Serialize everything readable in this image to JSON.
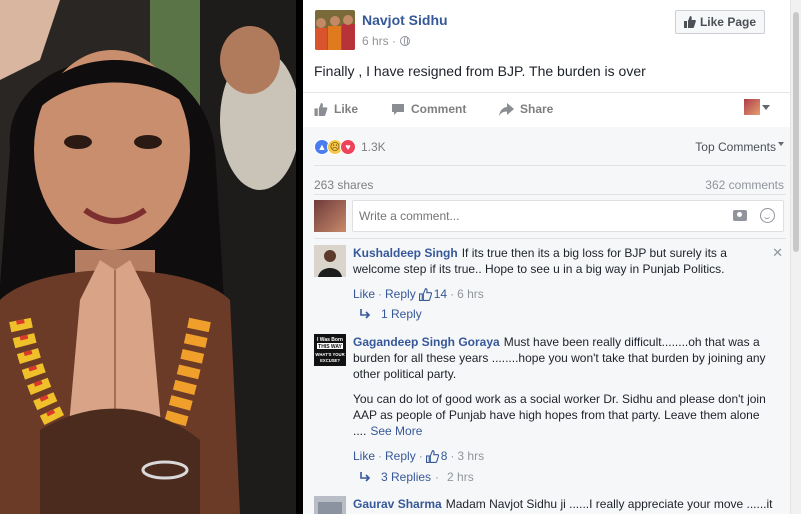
{
  "post": {
    "page_name": "Navjot Sidhu",
    "time": "6 hrs",
    "privacy_icon": "globe-icon",
    "like_page_label": "Like Page",
    "text": "Finally , I have resigned from BJP. The burden is over"
  },
  "actions": {
    "like_label": "Like",
    "comment_label": "Comment",
    "share_label": "Share"
  },
  "stats": {
    "reactions_count": "1.3K",
    "top_comments_label": "Top Comments",
    "shares": "263 shares",
    "comments": "362 comments"
  },
  "composer": {
    "placeholder": "Write a comment..."
  },
  "comments": [
    {
      "author": "Kushaldeep Singh",
      "text": "If its true then its a big loss for BJP but surely its a welcome step if its true.. Hope to see u in a big way in Punjab Politics.",
      "like": "Like",
      "reply": "Reply",
      "likes": "14",
      "time": "6 hrs",
      "replies": "1 Reply"
    },
    {
      "author": "Gagandeep Singh Goraya",
      "text": "Must have been really difficult........oh that was a burden for all these years ........hope you won't take that burden by joining any other political party.",
      "text2": "You can do lot of good work as a social worker Dr. Sidhu and please don't join AAP as people of Punjab have high hopes from that party. Leave them alone ....",
      "see_more": "See More",
      "avatar_text": [
        "I Was Born",
        "THIS WAY",
        "WHAT'S YOUR",
        "EXCUSE?"
      ],
      "like": "Like",
      "reply": "Reply",
      "likes": "8",
      "time": "3 hrs",
      "replies": "3 Replies",
      "replies_time": "2 hrs"
    },
    {
      "author": "Gaurav Sharma",
      "text": "Madam Navjot Sidhu ji ......I really appreciate your move ......it"
    }
  ],
  "colors": {
    "link_blue": "#365899",
    "reaction_like": "#4a7df0",
    "reaction_love": "#f0415a",
    "reaction_sad": "#f6c84a"
  }
}
